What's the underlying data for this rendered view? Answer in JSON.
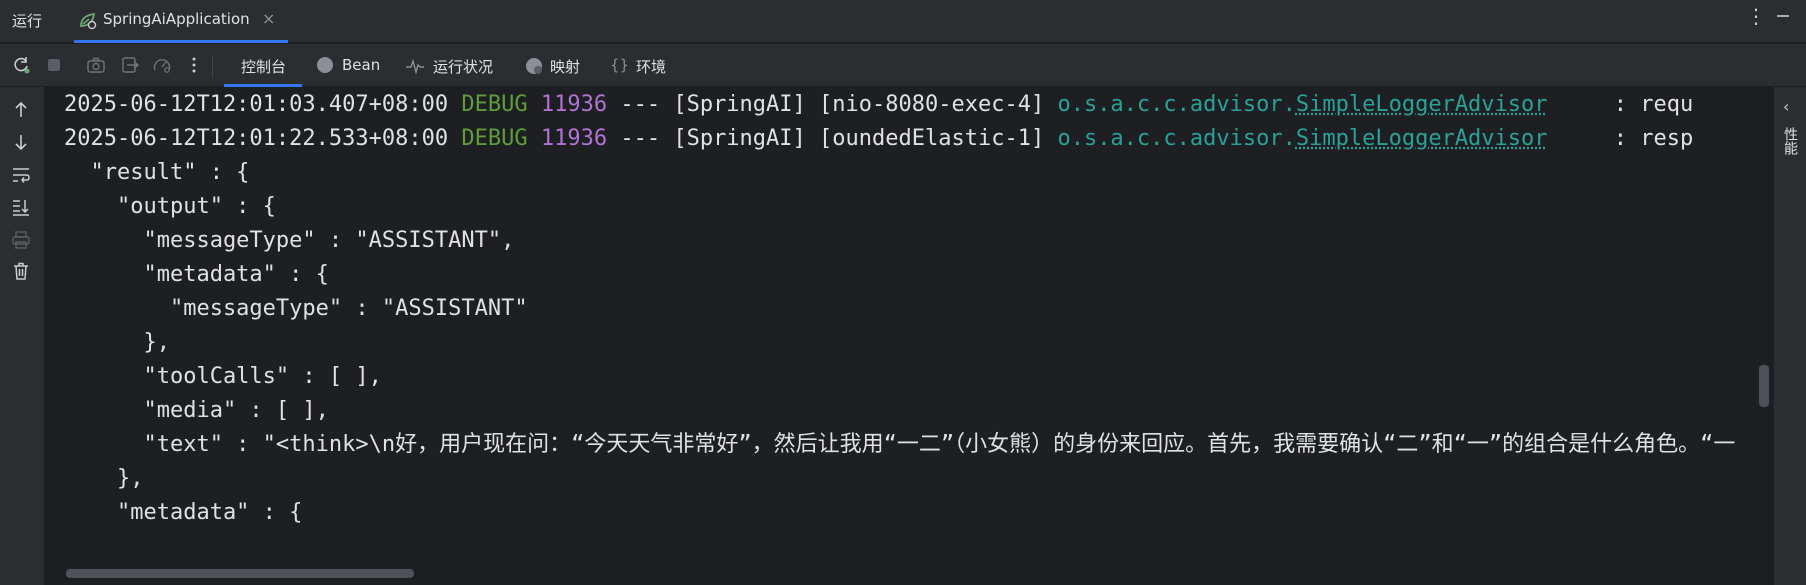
{
  "window": {
    "run_title": "运行",
    "tab_label": "SpringAiApplication",
    "tab_close": "×"
  },
  "toolbar": {
    "tabs": [
      {
        "label": "控制台",
        "active": true
      },
      {
        "label": "Bean",
        "icon": "bean-icon"
      },
      {
        "label": "运行状况",
        "icon": "health-icon"
      },
      {
        "label": "映射",
        "icon": "mapping-icon"
      },
      {
        "label": "环境",
        "icon": "environment-icon"
      }
    ],
    "more": "⋮"
  },
  "right_panel": {
    "label": "性能"
  },
  "console": {
    "log_lines": [
      {
        "timestamp": "2025-06-12T12:01:03.407+08:00",
        "level": "DEBUG",
        "pid": "11936",
        "dashes": "---",
        "app": "[SpringAI]",
        "thread": "[nio-8080-exec-4]",
        "logger_pkg": "o.s.a.c.c.advisor.",
        "logger_cls": "SimpleLoggerAdvisor",
        "message": "     : requ"
      },
      {
        "timestamp": "2025-06-12T12:01:22.533+08:00",
        "level": "DEBUG",
        "pid": "11936",
        "dashes": "---",
        "app": "[SpringAI]",
        "thread": "[oundedElastic-1]",
        "logger_pkg": "o.s.a.c.c.advisor.",
        "logger_cls": "SimpleLoggerAdvisor",
        "message": "     : resp"
      }
    ],
    "json_lines": [
      "  \"result\" : {",
      "    \"output\" : {",
      "      \"messageType\" : \"ASSISTANT\",",
      "      \"metadata\" : {",
      "        \"messageType\" : \"ASSISTANT\"",
      "      },",
      "      \"toolCalls\" : [ ],",
      "      \"media\" : [ ],",
      "      \"text\" : \"<think>\\n好，用户现在问：“今天天气非常好”，然后让我用“一二”（小女熊）的身份来回应。首先，我需要确认“二”和“一”的组合是什么角色。“一",
      "    },",
      "    \"metadata\" : {"
    ]
  },
  "colors": {
    "background": "#1e1f22",
    "panel": "#2b2d30",
    "accent": "#3574f0",
    "debug_level": "#5f9c3a",
    "pid": "#b073d3",
    "logger": "#2aa198"
  }
}
